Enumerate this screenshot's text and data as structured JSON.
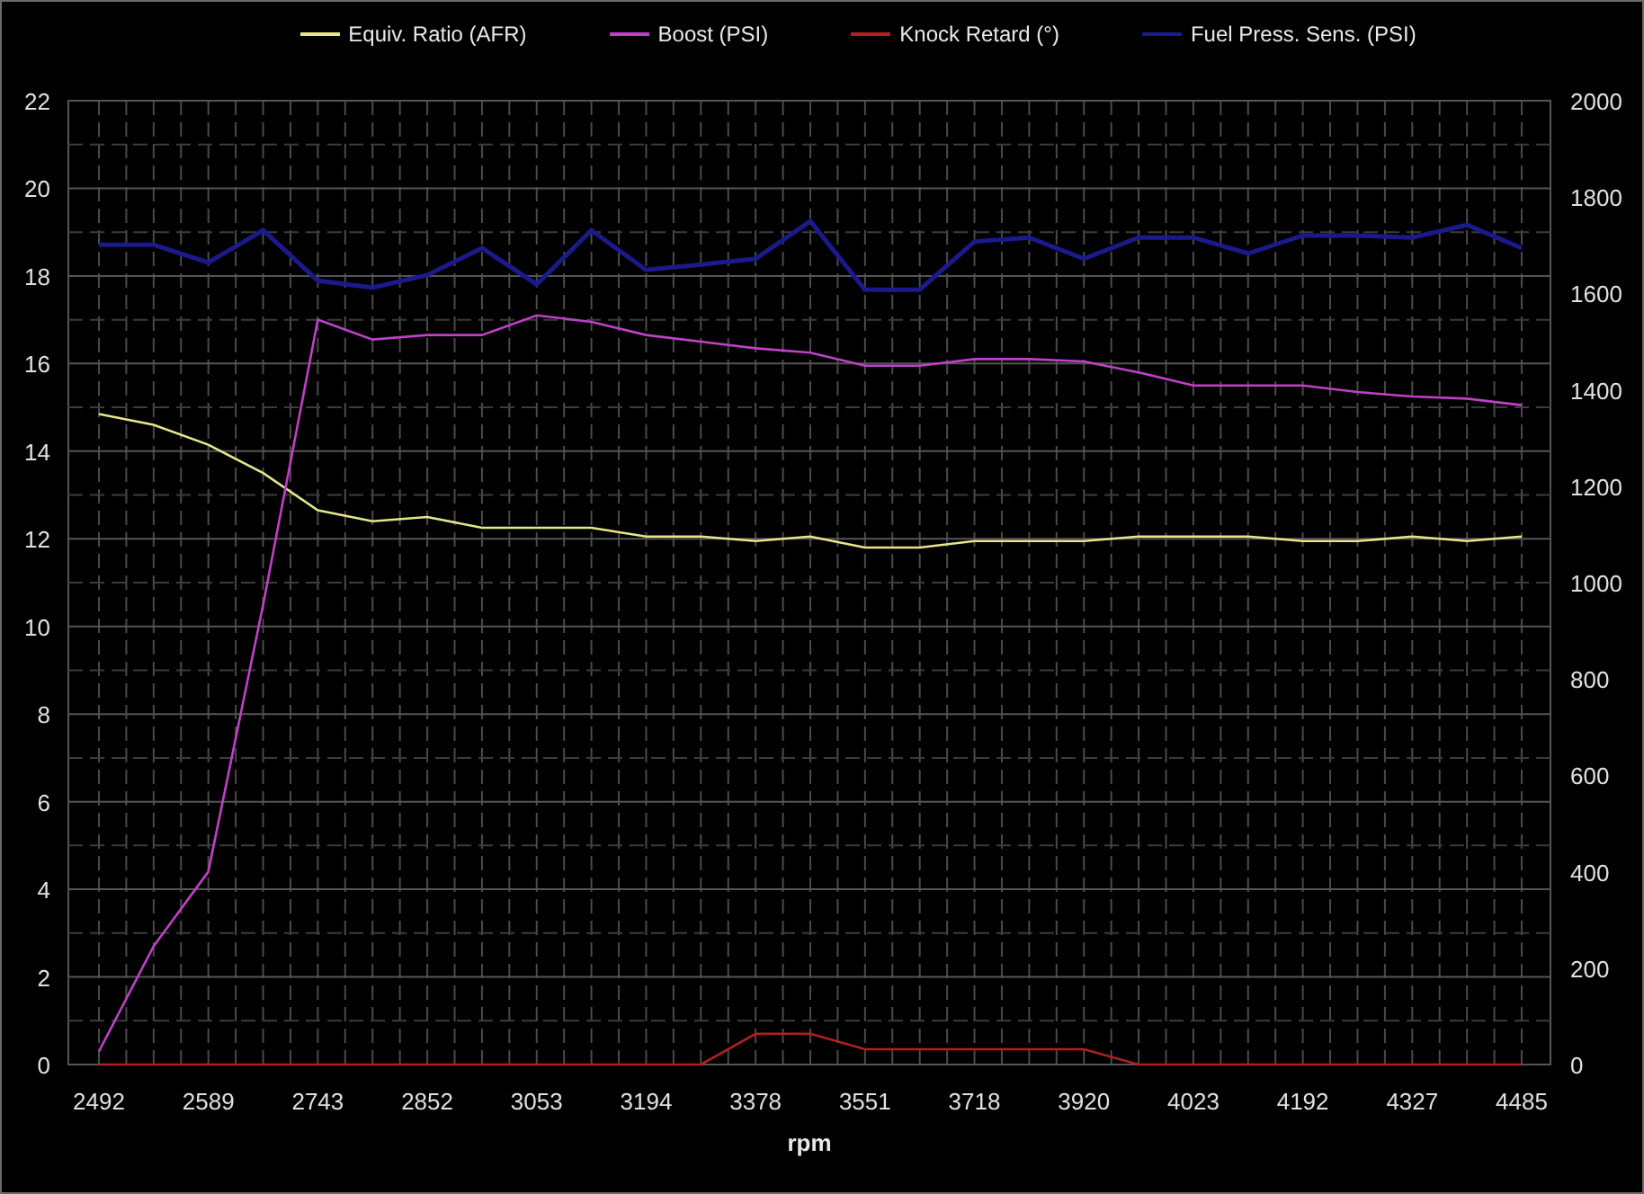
{
  "chart_data": {
    "type": "line",
    "xlabel": "rpm",
    "grid": true,
    "categories": [
      "2492",
      null,
      "2589",
      null,
      "2743",
      null,
      "2852",
      null,
      "3053",
      null,
      "3194",
      null,
      "3378",
      null,
      "3551",
      null,
      "3718",
      null,
      "3920",
      null,
      "4023",
      null,
      "4192",
      null,
      "4327",
      null,
      "4485"
    ],
    "ylim": [
      0,
      22
    ],
    "yticks": [
      0,
      2,
      4,
      6,
      8,
      10,
      12,
      14,
      16,
      18,
      20,
      22
    ],
    "y2lim": [
      0,
      2000
    ],
    "y2ticks": [
      0,
      200,
      400,
      600,
      800,
      1000,
      1200,
      1400,
      1600,
      1800,
      2000
    ],
    "series": [
      {
        "name": "Equiv. Ratio  (AFR)",
        "color": "#e6e68a",
        "values": [
          14.85,
          14.6,
          14.15,
          13.5,
          12.65,
          12.4,
          12.5,
          12.25,
          12.25,
          12.25,
          12.05,
          12.05,
          11.95,
          12.05,
          11.8,
          11.8,
          11.95,
          11.95,
          11.95,
          12.05,
          12.05,
          12.05,
          11.95,
          11.95,
          12.05,
          11.95,
          12.05
        ]
      },
      {
        "name": "Boost (PSI)",
        "color": "#c040c8",
        "values": [
          0.3,
          2.7,
          4.4,
          10.5,
          17,
          16.55,
          16.65,
          16.65,
          17.1,
          16.95,
          16.65,
          16.5,
          16.35,
          16.25,
          15.95,
          15.95,
          16.1,
          16.1,
          16.05,
          15.8,
          15.5,
          15.5,
          15.5,
          15.35,
          15.25,
          15.2,
          15.05
        ]
      },
      {
        "name": "Knock Retard  (°)",
        "color": "#b02020",
        "values": [
          0,
          0,
          0,
          0,
          0,
          0,
          0,
          0,
          0,
          0,
          0,
          0,
          0.7,
          0.7,
          0.35,
          0.35,
          0.35,
          0.35,
          0.35,
          0,
          0,
          0,
          0,
          0,
          0,
          0,
          0
        ]
      },
      {
        "name": "Fuel Press. Sens. (PSI)",
        "color": "#1a1a8c",
        "axis": "y2",
        "values": [
          1701,
          1701,
          1664,
          1731,
          1627,
          1612,
          1638,
          1694,
          1619,
          1731,
          1649,
          1660,
          1672,
          1750,
          1608,
          1608,
          1708,
          1716,
          1672,
          1716,
          1716,
          1683,
          1720,
          1720,
          1716,
          1742,
          1694
        ]
      }
    ]
  }
}
